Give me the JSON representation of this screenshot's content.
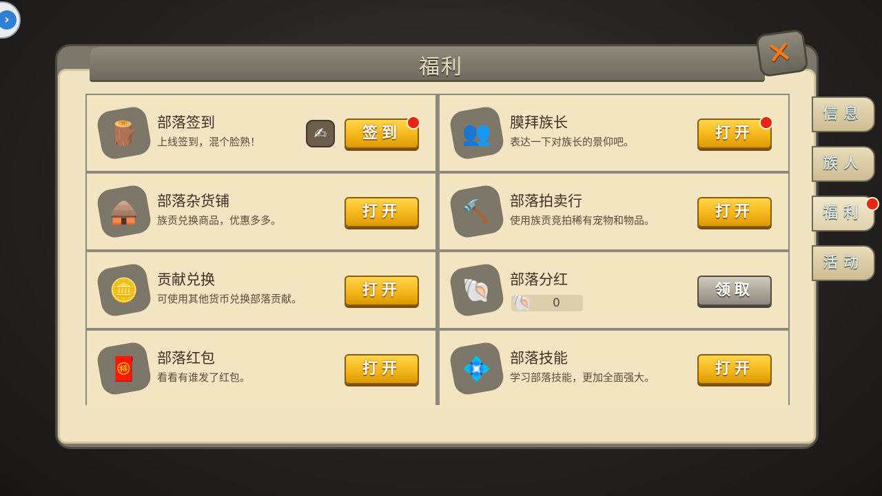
{
  "window": {
    "title": "福利"
  },
  "close_icon": "close-x-icon",
  "tabs": [
    {
      "label": "信息",
      "active": false
    },
    {
      "label": "族人",
      "active": false
    },
    {
      "label": "福利",
      "active": true,
      "badge": true
    },
    {
      "label": "活动",
      "active": false
    }
  ],
  "items": [
    {
      "title": "部落签到",
      "desc": "上线签到，混个脸熟！",
      "button": "签到",
      "icon": "stick-icon",
      "badge": true
    },
    {
      "title": "膜拜族长",
      "desc": "表达一下对族长的景仰吧。",
      "button": "打开",
      "icon": "chief-icon",
      "badge": true
    },
    {
      "title": "部落杂货铺",
      "desc": "族贡兑换商品，优惠多多。",
      "button": "打开",
      "icon": "shop-icon",
      "badge": false
    },
    {
      "title": "部落拍卖行",
      "desc": "使用族贡竞拍稀有宠物和物品。",
      "button": "打开",
      "icon": "hammer-icon",
      "badge": false
    },
    {
      "title": "贡献兑换",
      "desc": "可使用其他货币兑换部落贡献。",
      "button": "打开",
      "icon": "coin-exchange-icon",
      "badge": false
    },
    {
      "title": "部落分红",
      "desc": "",
      "button": "领取",
      "icon": "shells-icon",
      "badge": false,
      "shell_count": "0"
    },
    {
      "title": "部落红包",
      "desc": "看看有谁发了红包。",
      "button": "打开",
      "icon": "red-envelope-icon",
      "badge": false
    },
    {
      "title": "部落技能",
      "desc": "学习部落技能，更加全面强大。",
      "button": "打开",
      "icon": "skill-icon",
      "badge": false
    }
  ],
  "colors": {
    "button_yellow": "#f2b317",
    "button_gray": "#a8a397",
    "badge_red": "#e32618"
  }
}
